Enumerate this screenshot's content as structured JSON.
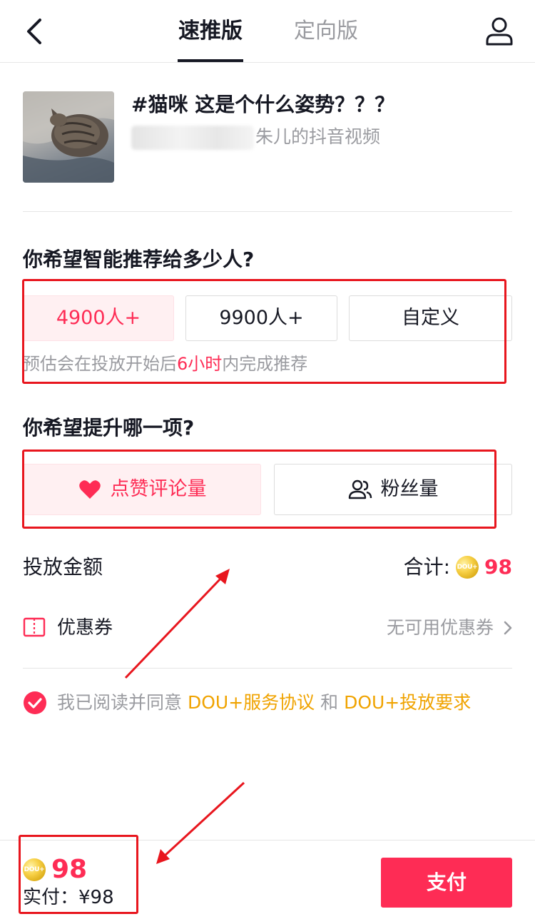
{
  "header": {
    "tabs": [
      {
        "label": "速推版",
        "active": true
      },
      {
        "label": "定向版",
        "active": false
      }
    ],
    "back_icon": "chevron-left-icon",
    "user_icon": "user-icon"
  },
  "video": {
    "title": "#猫咪 这是个什么姿势？？？",
    "subtitle_visible": "朱儿的抖音视频"
  },
  "reach": {
    "question": "你希望智能推荐给多少人?",
    "options": [
      {
        "label": "4900人+",
        "selected": true
      },
      {
        "label": "9900人+",
        "selected": false
      },
      {
        "label": "自定义",
        "selected": false
      }
    ],
    "hint_prefix": "预估会在投放开始后",
    "hint_highlight": "6小时",
    "hint_suffix": "内完成推荐"
  },
  "boost": {
    "question": "你希望提升哪一项?",
    "options": [
      {
        "label": "点赞评论量",
        "icon": "heart-icon",
        "selected": true
      },
      {
        "label": "粉丝量",
        "icon": "users-icon",
        "selected": false
      }
    ]
  },
  "amount": {
    "label": "投放金额",
    "total_label": "合计:",
    "coin_text": "DOU+",
    "total_value": "98"
  },
  "coupon": {
    "label": "优惠券",
    "value": "无可用优惠券",
    "icon": "coupon-icon"
  },
  "agreement": {
    "checked": true,
    "prefix": "我已阅读并同意",
    "link1": "DOU+服务协议",
    "and": "和",
    "link2": "DOU+投放要求"
  },
  "footer": {
    "coin_text": "DOU+",
    "total": "98",
    "paid_text": "实付：¥98",
    "pay_label": "支付"
  },
  "colors": {
    "accent": "#fe2c55",
    "link": "#f0a300",
    "annotation": "#e8161e"
  }
}
